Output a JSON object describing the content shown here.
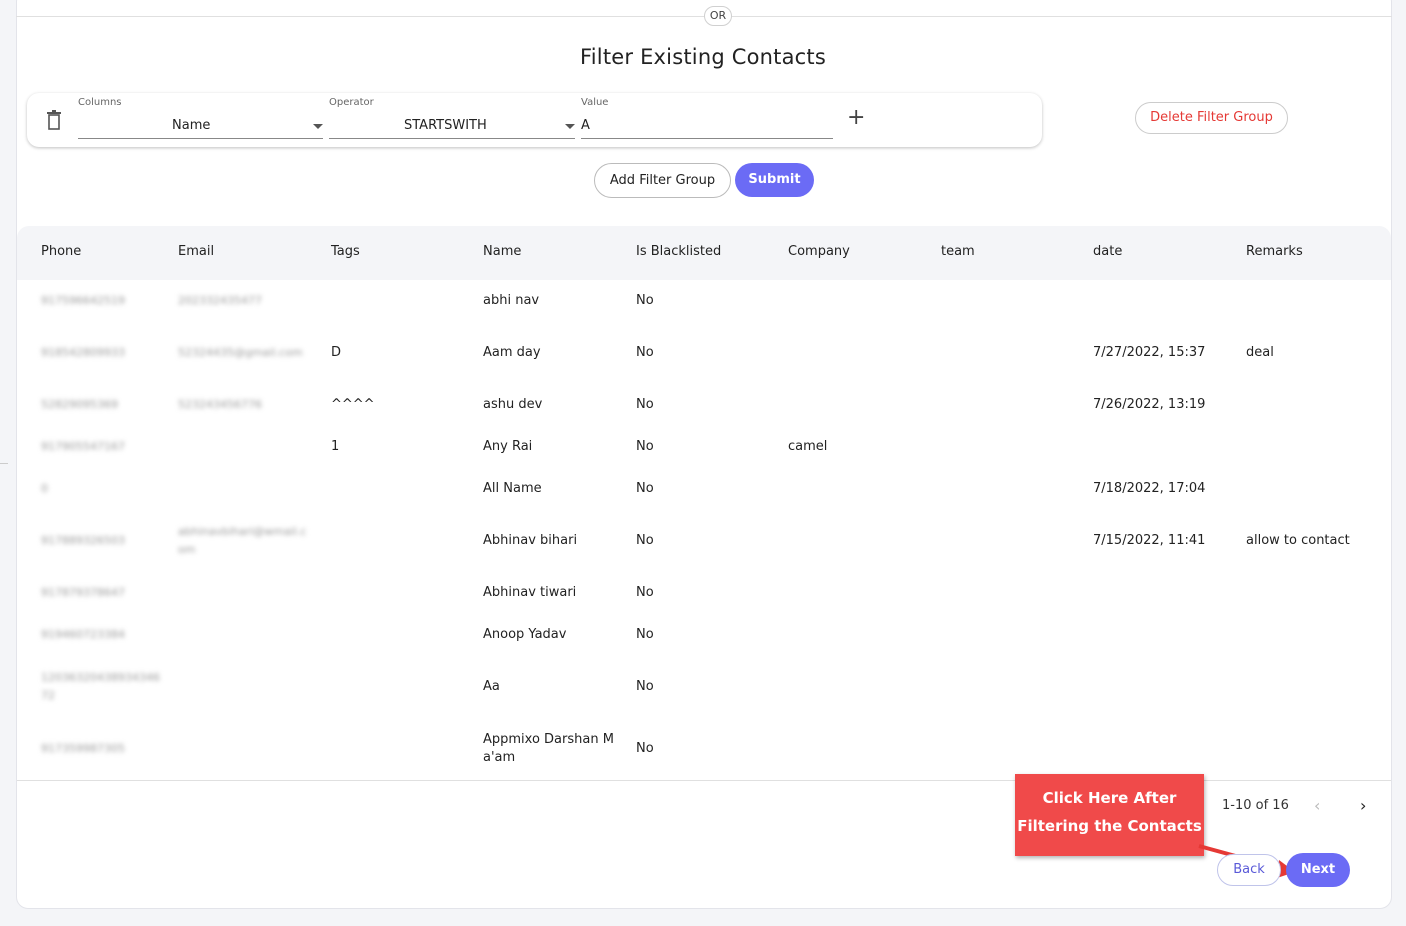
{
  "divider": {
    "or_label": "OR"
  },
  "page_title": "Filter Existing Contacts",
  "filter": {
    "columns_label": "Columns",
    "columns_value": "Name",
    "operator_label": "Operator",
    "operator_value": "STARTSWITH",
    "value_label": "Value",
    "value_value": "A",
    "delete_group_label": "Delete Filter Group",
    "add_group_label": "Add Filter Group",
    "submit_label": "Submit"
  },
  "table": {
    "headers": [
      "Phone",
      "Email",
      "Tags",
      "Name",
      "Is Blacklisted",
      "Company",
      "team",
      "date",
      "Remarks"
    ],
    "rows": [
      {
        "phone": "917596642519",
        "email": "202332435477",
        "tags": "",
        "name": "abhi nav",
        "blacklisted": "No",
        "company": "",
        "team": "",
        "date": "",
        "remarks": ""
      },
      {
        "phone": "918542809933",
        "email": "52324435@gmail.com",
        "tags": "D",
        "name": "Aam day",
        "blacklisted": "No",
        "company": "",
        "team": "",
        "date": "7/27/2022, 15:37",
        "remarks": "deal"
      },
      {
        "phone": "52829095369",
        "email": "523243456776",
        "tags": "^^^^",
        "name": "ashu dev",
        "blacklisted": "No",
        "company": "",
        "team": "",
        "date": "7/26/2022, 13:19",
        "remarks": ""
      },
      {
        "phone": "917905547167",
        "email": "",
        "tags": "1",
        "name": "Any Rai",
        "blacklisted": "No",
        "company": "camel",
        "team": "",
        "date": "",
        "remarks": ""
      },
      {
        "phone": "0",
        "email": "",
        "tags": "",
        "name": "All Name",
        "blacklisted": "No",
        "company": "",
        "team": "",
        "date": "7/18/2022, 17:04",
        "remarks": ""
      },
      {
        "phone": "917889326503",
        "email": "abhinavbihari@wmail.com",
        "tags": "",
        "name": "Abhinav bihari",
        "blacklisted": "No",
        "company": "",
        "team": "",
        "date": "7/15/2022, 11:41",
        "remarks": "allow to contact"
      },
      {
        "phone": "917879378647",
        "email": "",
        "tags": "",
        "name": "Abhinav tiwari",
        "blacklisted": "No",
        "company": "",
        "team": "",
        "date": "",
        "remarks": ""
      },
      {
        "phone": "919460723384",
        "email": "",
        "tags": "",
        "name": "Anoop Yadav",
        "blacklisted": "No",
        "company": "",
        "team": "",
        "date": "",
        "remarks": ""
      },
      {
        "phone": "1203632043893434672",
        "email": "",
        "tags": "",
        "name": "Aa",
        "blacklisted": "No",
        "company": "",
        "team": "",
        "date": "",
        "remarks": ""
      },
      {
        "phone": "917359987305",
        "email": "",
        "tags": "",
        "name": "Appmixo Darshan Ma'am",
        "blacklisted": "No",
        "company": "",
        "team": "",
        "date": "",
        "remarks": ""
      }
    ]
  },
  "pagination": {
    "range_text": "1-10 of 16"
  },
  "callout": {
    "line1": "Click Here After",
    "line2": "Filtering the Contacts"
  },
  "nav": {
    "back_label": "Back",
    "next_label": "Next"
  },
  "colors": {
    "primary": "#6b6bf5",
    "danger": "#e53935",
    "callout": "#f04a4a"
  }
}
